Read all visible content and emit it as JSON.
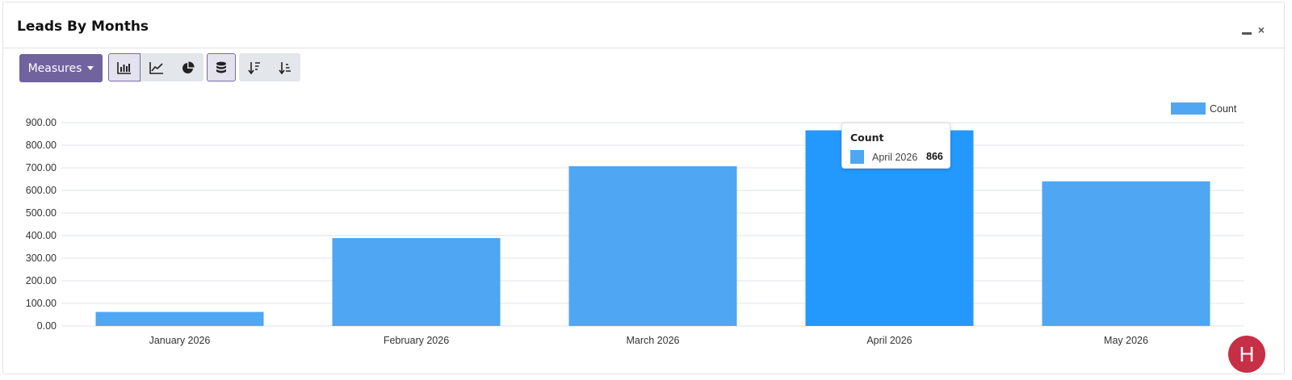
{
  "dashboard": {
    "title": "Leads By Months",
    "minimize_icon": "minimize-icon",
    "close_icon": "close-icon",
    "close_glyph": "×"
  },
  "toolbar": {
    "measures_label": "Measures",
    "buttons": [
      {
        "icon": "bar-chart-icon",
        "active": true
      },
      {
        "icon": "line-chart-icon",
        "active": false
      },
      {
        "icon": "pie-chart-icon",
        "active": false
      },
      {
        "icon": "database-stack-icon",
        "active": true
      },
      {
        "icon": "sort-descending-icon",
        "active": false
      },
      {
        "icon": "sort-ascending-icon",
        "active": false
      }
    ]
  },
  "chart_data": {
    "type": "bar",
    "categories": [
      "January 2026",
      "February 2026",
      "March 2026",
      "April 2026",
      "May 2026"
    ],
    "series": [
      {
        "name": "Count",
        "values": [
          62,
          389,
          707,
          866,
          640
        ]
      }
    ],
    "ylim": [
      0,
      900
    ],
    "yticks": [
      "0.00",
      "100.00",
      "200.00",
      "300.00",
      "400.00",
      "500.00",
      "600.00",
      "700.00",
      "800.00",
      "900.00"
    ],
    "grid": true,
    "legend_position": "top-right",
    "highlighted_index": 3,
    "colors": {
      "bar": "#4fa6f2",
      "bar_highlight": "#2499fd"
    }
  },
  "tooltip": {
    "title": "Count",
    "label": "April 2026",
    "value": "866"
  },
  "help_button": {
    "label": "H",
    "color": "#c62f45"
  }
}
